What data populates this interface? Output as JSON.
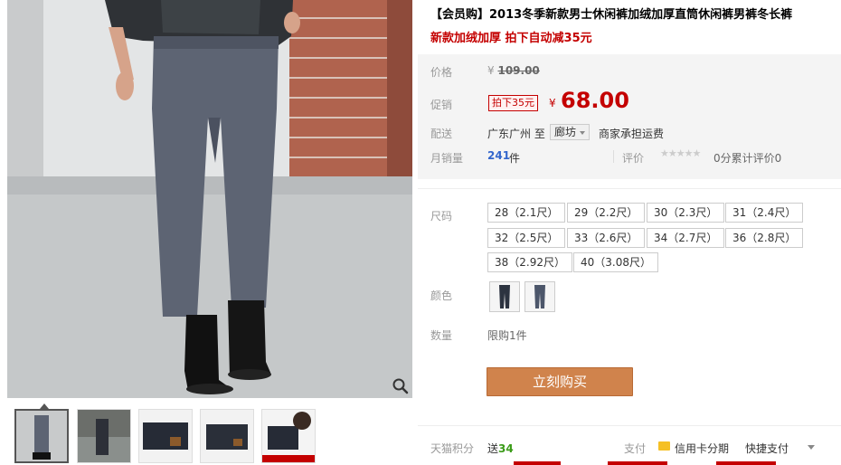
{
  "product": {
    "title": "【会员购】2013冬季新款男士休闲裤加绒加厚直筒休闲裤男裤冬长裤",
    "subtitle": "新款加绒加厚 拍下自动减35元"
  },
  "price": {
    "label": "价格",
    "original_yen": "¥",
    "original": "109.00",
    "promo_label": "促销",
    "promo_tag": "拍下35元",
    "current_yen": "¥",
    "current": "68.00"
  },
  "shipping": {
    "label": "配送",
    "from": "广东广州 至",
    "to": "廊坊",
    "fee": "商家承担运费"
  },
  "sales": {
    "label": "月销量",
    "count": "241",
    "unit": "件",
    "review_label": "评价",
    "stars": "★★★★★",
    "review_count": "0分累计评价0"
  },
  "sizes": {
    "label": "尺码",
    "options": [
      "28（2.1尺）",
      "29（2.2尺）",
      "30（2.3尺）",
      "31（2.4尺）",
      "32（2.5尺）",
      "33（2.6尺）",
      "34（2.7尺）",
      "36（2.8尺）",
      "38（2.92尺）",
      "40（3.08尺）"
    ]
  },
  "colors": {
    "label": "颜色"
  },
  "quantity": {
    "label": "数量",
    "limit": "限购1件"
  },
  "buy": {
    "label": "立刻购买"
  },
  "footer": {
    "points_label": "天猫积分",
    "points_prefix": "送",
    "points_value": "34",
    "pay_label": "支付",
    "credit_label": "信用卡分期",
    "quick_pay": "快捷支付"
  },
  "icons": {
    "zoom": "magnifier-icon",
    "card": "credit-card-icon",
    "dropdown": "chevron-down-icon",
    "star": "star-icon"
  },
  "colors_theme": {
    "accent_red": "#c40000",
    "buy_button": "#d0834c",
    "link_blue": "#3366cc",
    "points_green": "#3a9b18"
  }
}
